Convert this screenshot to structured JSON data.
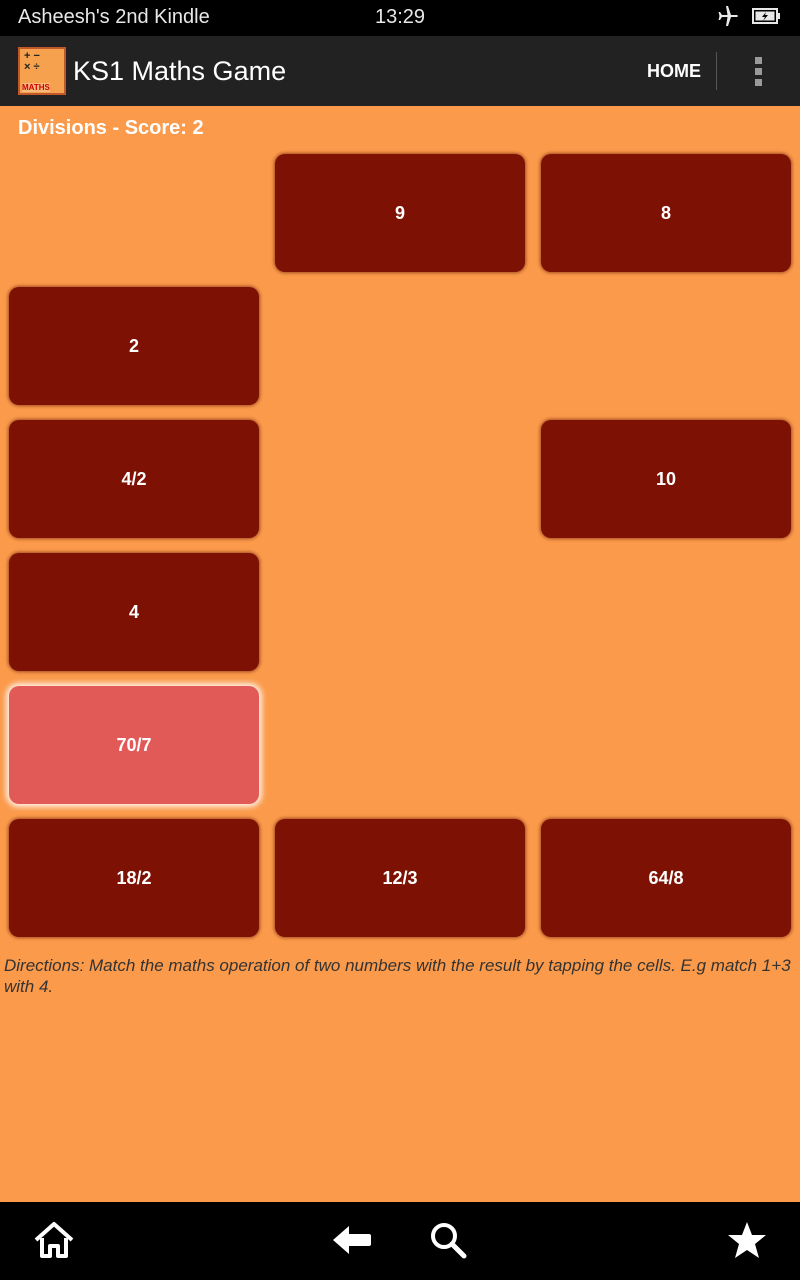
{
  "status_bar": {
    "device_name": "Asheesh's 2nd Kindle",
    "time": "13:29",
    "icons": [
      "airplane-mode-icon",
      "battery-charging-icon"
    ]
  },
  "action_bar": {
    "app_icon_label": "MATHS",
    "title": "KS1 Maths Game",
    "home_label": "HOME"
  },
  "game": {
    "score_label": "Divisions - Score: 2",
    "cells": {
      "r1c2": "9",
      "r1c3": "8",
      "r2c1": "2",
      "r3c1": "4/2",
      "r3c3": "10",
      "r4c1": "4",
      "r5c1": "70/7",
      "r6c1": "18/2",
      "r6c2": "12/3",
      "r6c3": "64/8"
    },
    "selected_cell": "70/7",
    "directions": "Directions: Match the maths operation of two numbers with the result by tapping the cells. E.g match 1+3 with 4."
  },
  "colors": {
    "background": "#fb9a4a",
    "cell": "#7d1204",
    "cell_selected": "#e25a57"
  },
  "nav_bar": {
    "icons": [
      "home-icon",
      "back-icon",
      "search-icon",
      "favorites-star-icon"
    ]
  }
}
